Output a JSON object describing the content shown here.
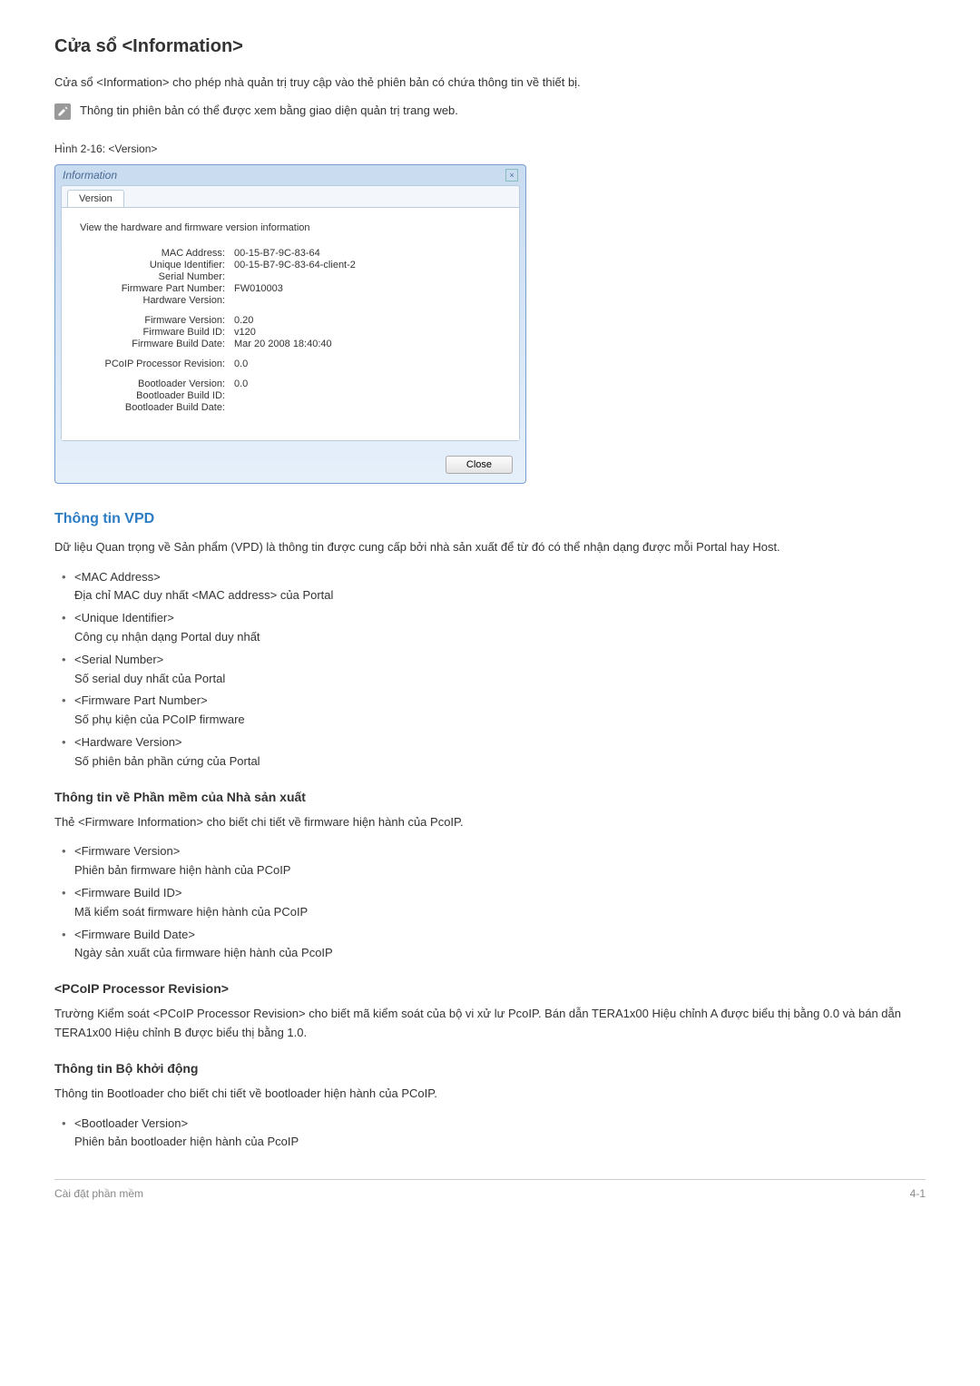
{
  "title": "Cửa sổ <Information>",
  "intro": "Cửa sổ <Information> cho phép nhà quản trị truy cập vào thẻ phiên bản có chứa thông tin về thiết bị.",
  "note": "Thông tin phiên bản có thể được xem bằng giao diện quản trị trang web.",
  "figLabel": "Hı̀nh 2-16: <Version>",
  "dialog": {
    "title": "Information",
    "tab": "Version",
    "intro": "View the hardware and firmware version information",
    "group1": [
      {
        "label": "MAC Address:",
        "value": "00-15-B7-9C-83-64"
      },
      {
        "label": "Unique Identifier:",
        "value": "00-15-B7-9C-83-64-client-2"
      },
      {
        "label": "Serial Number:",
        "value": ""
      },
      {
        "label": "Firmware Part Number:",
        "value": "FW010003"
      },
      {
        "label": "Hardware Version:",
        "value": ""
      }
    ],
    "group2": [
      {
        "label": "Firmware Version:",
        "value": "0.20"
      },
      {
        "label": "Firmware Build ID:",
        "value": "v120"
      },
      {
        "label": "Firmware Build Date:",
        "value": "Mar 20 2008 18:40:40"
      }
    ],
    "group3": [
      {
        "label": "PCoIP Processor Revision:",
        "value": "0.0"
      }
    ],
    "group4": [
      {
        "label": "Bootloader Version:",
        "value": "0.0"
      },
      {
        "label": "Bootloader Build ID:",
        "value": ""
      },
      {
        "label": "Bootloader Build Date:",
        "value": ""
      }
    ],
    "closeBtn": "Close"
  },
  "vpd": {
    "heading": "Thông tin VPD",
    "desc": "Dữ liệu Quan trọng về Sản phẩm (VPD) là thông tin được cung cấp bởi nhà sản xuất để từ đó có thể nhận dạng được mỗi Portal hay Host.",
    "items": [
      {
        "term": "<MAC Address>",
        "desc": "Địa chỉ MAC duy nhất <MAC address> của Portal"
      },
      {
        "term": "<Unique Identifier>",
        "desc": "Công cụ nhận dạng Portal duy nhất"
      },
      {
        "term": "<Serial Number>",
        "desc": "Số serial duy nhất của Portal"
      },
      {
        "term": "<Firmware Part Number>",
        "desc": "Số phụ kiện của PCoIP firmware"
      },
      {
        "term": "<Hardware Version>",
        "desc": "Số phiên bản phần cứng của Portal"
      }
    ]
  },
  "fw": {
    "heading": "Thông tin về Phần mềm của Nhà sản xuất",
    "desc": "Thẻ <Firmware Information> cho biết chi tiết về firmware hiện hành của PcoIP.",
    "items": [
      {
        "term": "<Firmware Version>",
        "desc": "Phiên bản firmware hiện hành của PCoIP"
      },
      {
        "term": "<Firmware Build ID>",
        "desc": "Mã kiểm soát firmware hiện hành của PCoIP"
      },
      {
        "term": "<Firmware Build Date>",
        "desc": "Ngày sản xuất của firmware hiện hành của PcoIP"
      }
    ]
  },
  "proc": {
    "heading": "<PCoIP Processor Revision>",
    "desc": "Trường Kiểm soát <PCoIP Processor Revision> cho biết mã kiểm soát của bộ vi xử lư PcoIP. Bán dẫn TERA1x00 Hiệu chỉnh A được biểu thị bằng 0.0 và bán dẫn TERA1x00 Hiệu chỉnh B được biểu thị bằng 1.0."
  },
  "boot": {
    "heading": "Thông tin Bộ khởi động",
    "desc": "Thông tin Bootloader cho biết chi tiết về bootloader hiện hành của PCoIP.",
    "items": [
      {
        "term": "<Bootloader Version>",
        "desc": "Phiên bản bootloader hiện hành của PcoIP"
      }
    ]
  },
  "footer": {
    "left": "Cài đặt phần mềm",
    "right": "4-1"
  }
}
